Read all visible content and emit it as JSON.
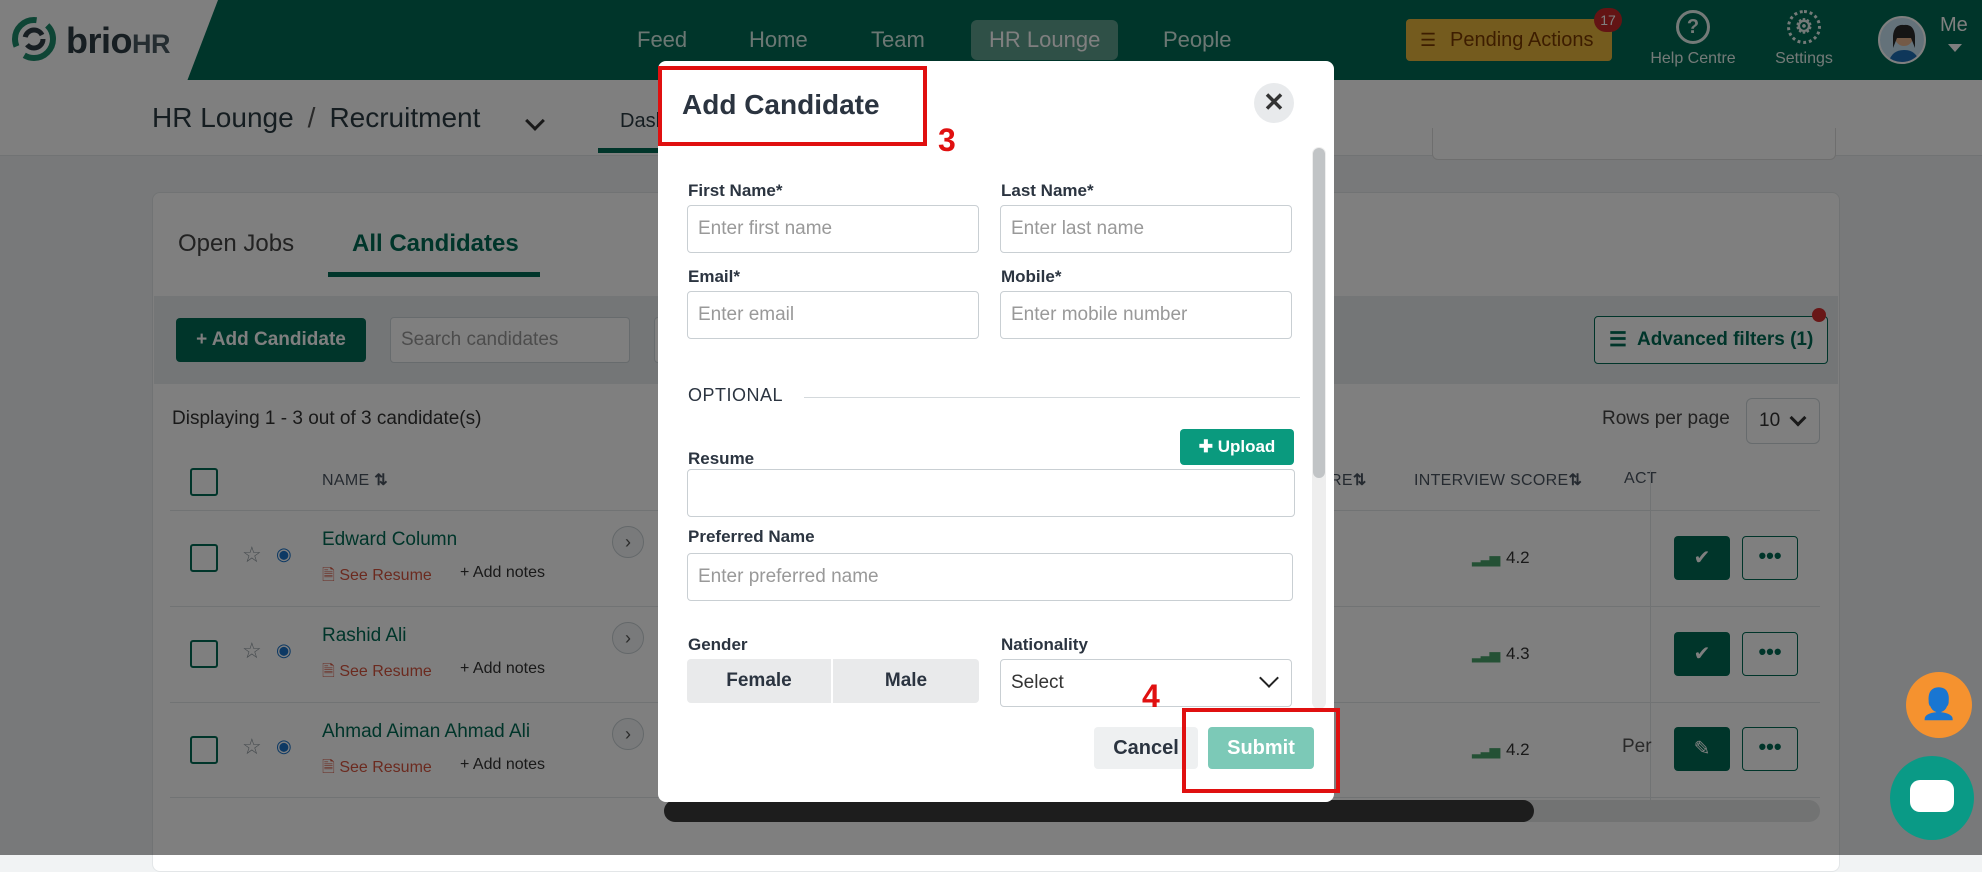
{
  "brand": {
    "name": "brio",
    "suffix": "HR"
  },
  "nav": {
    "feed": "Feed",
    "home": "Home",
    "team": "Team",
    "hr_lounge": "HR Lounge",
    "people": "People"
  },
  "topbar": {
    "pending_actions": "Pending Actions",
    "pending_count": "17",
    "help_centre": "Help Centre",
    "settings": "Settings",
    "me": "Me"
  },
  "breadcrumb": {
    "section": "HR Lounge",
    "separator": "/",
    "page": "Recruitment"
  },
  "subtabs": {
    "dashboard": "Dash"
  },
  "tabs": {
    "open_jobs": "Open Jobs",
    "all_candidates": "All Candidates"
  },
  "toolbar": {
    "add_candidate": "+ Add Candidate",
    "search_placeholder": "Search candidates",
    "advanced_filters": "Advanced filters (1)"
  },
  "table": {
    "displaying": "Displaying 1 - 3 out of 3 candidate(s)",
    "rows_per_page_label": "Rows per page",
    "rows_per_page_value": "10",
    "headers": {
      "name": "NAME",
      "score_partial": "RE",
      "interview_score": "INTERVIEW SCORE",
      "actions_partial": "ACT"
    },
    "rows": [
      {
        "name": "Edward Column",
        "see_resume": "See Resume",
        "add_notes": "+ Add notes",
        "interview_score": "4.2"
      },
      {
        "name": "Rashid Ali",
        "see_resume": "See Resume",
        "add_notes": "+ Add notes",
        "interview_score": "4.3"
      },
      {
        "name": "Ahmad Aiman Ahmad Ali",
        "see_resume": "See Resume",
        "add_notes": "+ Add notes",
        "interview_score": "4.2",
        "status_partial": "Per"
      }
    ]
  },
  "modal": {
    "title": "Add Candidate",
    "first_name_label": "First Name*",
    "first_name_placeholder": "Enter first name",
    "last_name_label": "Last Name*",
    "last_name_placeholder": "Enter last name",
    "email_label": "Email*",
    "email_placeholder": "Enter email",
    "mobile_label": "Mobile*",
    "mobile_placeholder": "Enter mobile number",
    "optional": "OPTIONAL",
    "upload": "Upload",
    "resume_label": "Resume",
    "preferred_name_label": "Preferred Name",
    "preferred_name_placeholder": "Enter preferred name",
    "gender_label": "Gender",
    "gender_female": "Female",
    "gender_male": "Male",
    "nationality_label": "Nationality",
    "nationality_value": "Select",
    "cancel": "Cancel",
    "submit": "Submit"
  },
  "annotations": {
    "step_title": "3",
    "step_submit": "4"
  },
  "colors": {
    "brand_green": "#006b54",
    "accent_teal": "#0a9a7e",
    "pending_yellow": "#e9b73d",
    "annotation_red": "#e01010"
  }
}
